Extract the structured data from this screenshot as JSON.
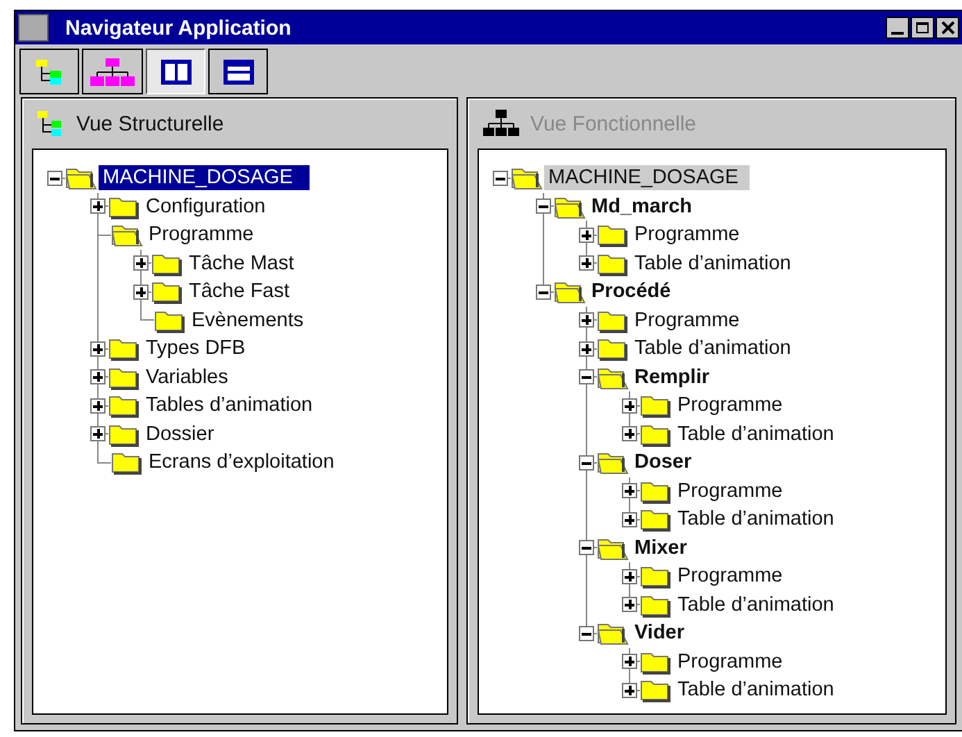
{
  "window": {
    "title": "Navigateur Application"
  },
  "toolbar": [
    {
      "kind": "tree",
      "pressed": false
    },
    {
      "kind": "hierarchy",
      "pressed": false
    },
    {
      "kind": "columns",
      "pressed": true
    },
    {
      "kind": "rows",
      "pressed": false
    }
  ],
  "panels": [
    {
      "title": "Vue Structurelle",
      "kind": "tree",
      "active": true,
      "tree": [
        {
          "label": "MACHINE_DOSAGE",
          "toggle": true,
          "expanded": true,
          "selected": true,
          "bold": false,
          "children": [
            {
              "label": "Configuration",
              "toggle": true,
              "expanded": false,
              "selected": false,
              "bold": false
            },
            {
              "label": "Programme",
              "toggle": false,
              "expanded": true,
              "selected": false,
              "bold": false,
              "children": [
                {
                  "label": "Tâche Mast",
                  "toggle": true,
                  "expanded": false,
                  "selected": false,
                  "bold": false
                },
                {
                  "label": "Tâche Fast",
                  "toggle": true,
                  "expanded": false,
                  "selected": false,
                  "bold": false
                },
                {
                  "label": "Evènements",
                  "toggle": false,
                  "expanded": false,
                  "selected": false,
                  "bold": false
                }
              ]
            },
            {
              "label": "Types DFB",
              "toggle": true,
              "expanded": false,
              "selected": false,
              "bold": false
            },
            {
              "label": "Variables",
              "toggle": true,
              "expanded": false,
              "selected": false,
              "bold": false
            },
            {
              "label": "Tables d’animation",
              "toggle": true,
              "expanded": false,
              "selected": false,
              "bold": false
            },
            {
              "label": "Dossier",
              "toggle": true,
              "expanded": false,
              "selected": false,
              "bold": false
            },
            {
              "label": "Ecrans d’exploitation",
              "toggle": false,
              "expanded": false,
              "selected": false,
              "bold": false
            }
          ]
        }
      ]
    },
    {
      "title": "Vue Fonctionnelle",
      "kind": "hierarchy",
      "active": false,
      "tree": [
        {
          "label": "MACHINE_DOSAGE",
          "toggle": true,
          "expanded": true,
          "selected": true,
          "bold": false,
          "children": [
            {
              "label": "Md_march",
              "toggle": true,
              "expanded": true,
              "selected": false,
              "bold": true,
              "children": [
                {
                  "label": "Programme",
                  "toggle": true,
                  "expanded": false,
                  "selected": false,
                  "bold": false
                },
                {
                  "label": "Table d’animation",
                  "toggle": true,
                  "expanded": false,
                  "selected": false,
                  "bold": false
                }
              ]
            },
            {
              "label": "Procédé",
              "toggle": true,
              "expanded": true,
              "selected": false,
              "bold": true,
              "children": [
                {
                  "label": "Programme",
                  "toggle": true,
                  "expanded": false,
                  "selected": false,
                  "bold": false
                },
                {
                  "label": "Table d’animation",
                  "toggle": true,
                  "expanded": false,
                  "selected": false,
                  "bold": false
                },
                {
                  "label": "Remplir",
                  "toggle": true,
                  "expanded": true,
                  "selected": false,
                  "bold": true,
                  "children": [
                    {
                      "label": "Programme",
                      "toggle": true,
                      "expanded": false,
                      "selected": false,
                      "bold": false
                    },
                    {
                      "label": "Table d’animation",
                      "toggle": true,
                      "expanded": false,
                      "selected": false,
                      "bold": false
                    }
                  ]
                },
                {
                  "label": "Doser",
                  "toggle": true,
                  "expanded": true,
                  "selected": false,
                  "bold": true,
                  "children": [
                    {
                      "label": "Programme",
                      "toggle": true,
                      "expanded": false,
                      "selected": false,
                      "bold": false
                    },
                    {
                      "label": "Table d’animation",
                      "toggle": true,
                      "expanded": false,
                      "selected": false,
                      "bold": false
                    }
                  ]
                },
                {
                  "label": "Mixer",
                  "toggle": true,
                  "expanded": true,
                  "selected": false,
                  "bold": true,
                  "children": [
                    {
                      "label": "Programme",
                      "toggle": true,
                      "expanded": false,
                      "selected": false,
                      "bold": false
                    },
                    {
                      "label": "Table d’animation",
                      "toggle": true,
                      "expanded": false,
                      "selected": false,
                      "bold": false
                    }
                  ]
                },
                {
                  "label": "Vider",
                  "toggle": true,
                  "expanded": true,
                  "selected": false,
                  "bold": true,
                  "children": [
                    {
                      "label": "Programme",
                      "toggle": true,
                      "expanded": false,
                      "selected": false,
                      "bold": false
                    },
                    {
                      "label": "Table d’animation",
                      "toggle": true,
                      "expanded": false,
                      "selected": false,
                      "bold": false
                    }
                  ]
                }
              ]
            }
          ]
        }
      ]
    }
  ]
}
